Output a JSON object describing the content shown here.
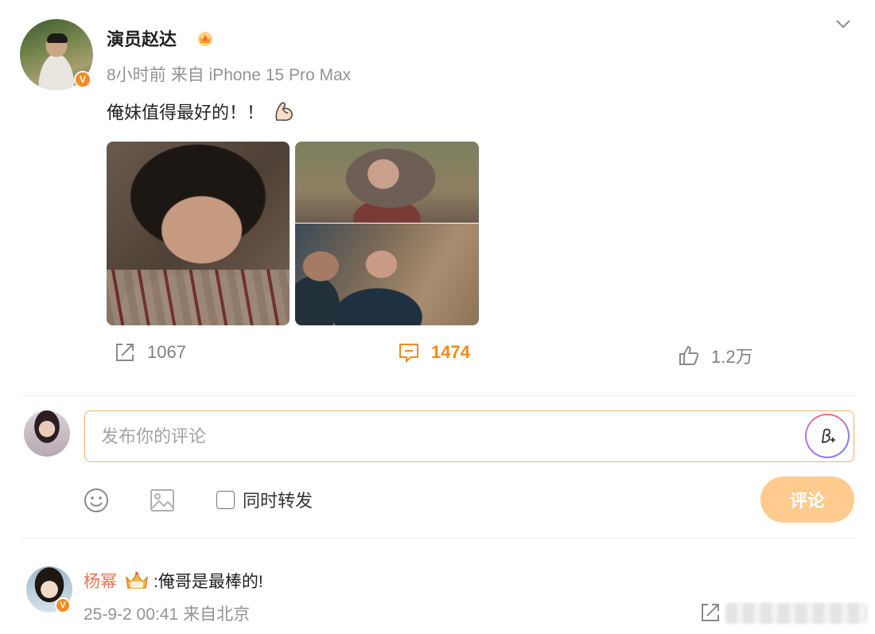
{
  "post": {
    "author": "演员赵达",
    "time": "8小时前",
    "source": "来自 iPhone 15 Pro Max",
    "text": "俺妹值得最好的！！",
    "verified_badge": "V",
    "images": [
      "post-image-1",
      "post-image-2-top",
      "post-image-2-bottom"
    ]
  },
  "actions": {
    "share_count": "1067",
    "comment_count": "1474",
    "like_count": "1.2万"
  },
  "composer": {
    "placeholder": "发布你的评论",
    "repost_label": "同时转发",
    "submit_label": "评论"
  },
  "reply": {
    "user": "杨幂",
    "text": ":俺哥是最棒的!",
    "date": "25-9-2 00:41",
    "location": "来自北京",
    "verified_badge": "V"
  },
  "colors": {
    "accent_orange": "#f28a1c",
    "username_orange": "#eb7350",
    "submit_disabled": "#ffcb8f",
    "input_border": "#f3b266"
  },
  "icons": [
    "crown-icon",
    "chevron-down-icon",
    "flexed-biceps-icon",
    "share-icon",
    "comment-icon",
    "like-icon",
    "ai-pen-icon",
    "emoji-icon",
    "image-icon",
    "vip-crown-icon"
  ]
}
